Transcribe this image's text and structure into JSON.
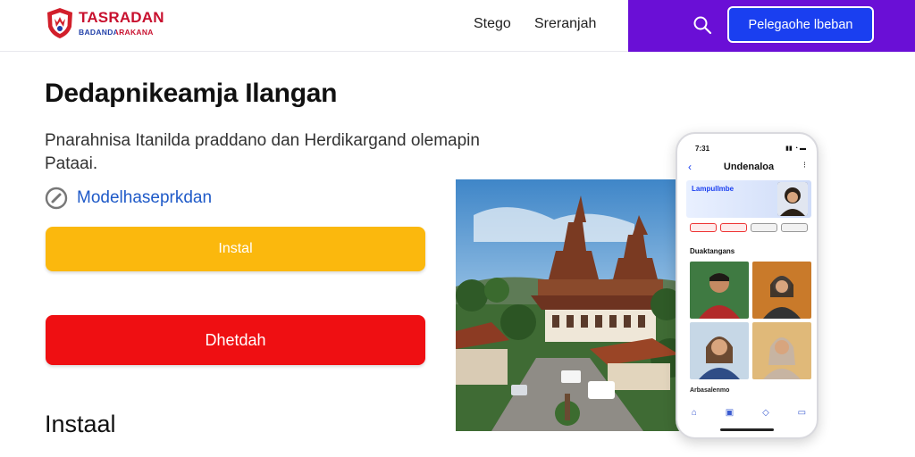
{
  "header": {
    "logo_name": "TASRADAN",
    "logo_sub": "BADANDARAKANA",
    "nav": [
      "Stego",
      "Sreranjah"
    ],
    "cta_label": "Pelegaohe lbeban",
    "accent_color": "#6a0fd6",
    "icons": {
      "logo": "shield-logo-icon",
      "search": "search-icon"
    }
  },
  "main": {
    "title": "Dedapnikeamja Ilangan",
    "description": "Pnarahnisa Itanilda praddano dan Herdikargand olemapin Pataai.",
    "model_link": "Modelhaseprkdan",
    "model_icon": "compass-icon",
    "install_button": "Instal",
    "red_button": "Dhetdah",
    "bottom_heading": "Instaal",
    "colors": {
      "install": "#fbb80d",
      "red": "#ef0f12"
    }
  },
  "phone": {
    "time": "7:31",
    "title": "Undenaloa",
    "banner_text": "Lampullmbe",
    "section_title": "Duaktangans",
    "caption": "Arbasalenmo",
    "nav_icons": [
      "home-icon",
      "grid-icon",
      "bell-icon",
      "profile-icon"
    ]
  }
}
